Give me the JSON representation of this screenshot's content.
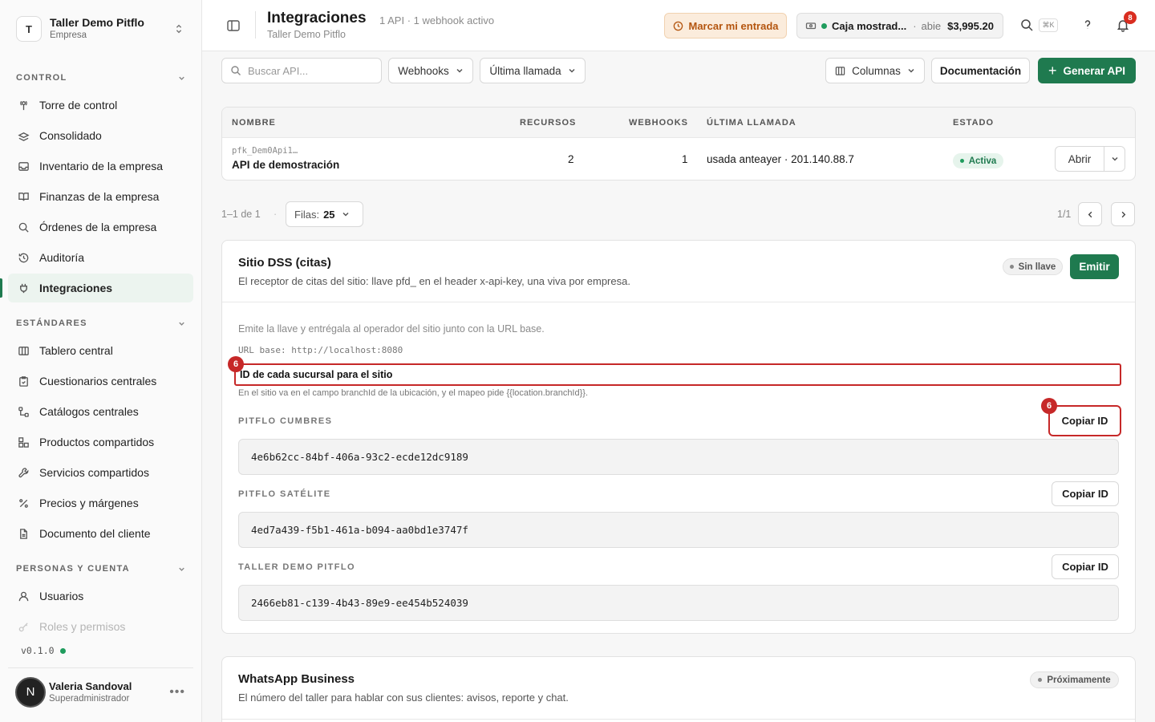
{
  "workspace": {
    "initial": "T",
    "name": "Taller Demo Pitflo",
    "type": "Empresa"
  },
  "sidebar": {
    "sections": [
      {
        "label": "CONTROL"
      },
      {
        "label": "ESTÁNDARES"
      },
      {
        "label": "PERSONAS Y CUENTA"
      }
    ],
    "items": [
      {
        "label": "Torre de control",
        "icon": "tower-icon"
      },
      {
        "label": "Consolidado",
        "icon": "layers-icon"
      },
      {
        "label": "Inventario de la empresa",
        "icon": "inbox-icon"
      },
      {
        "label": "Finanzas de la empresa",
        "icon": "book-icon"
      },
      {
        "label": "Órdenes de la empresa",
        "icon": "search-icon"
      },
      {
        "label": "Auditoría",
        "icon": "history-icon"
      },
      {
        "label": "Integraciones",
        "icon": "plug-icon"
      },
      {
        "label": "Tablero central",
        "icon": "columns-icon"
      },
      {
        "label": "Cuestionarios centrales",
        "icon": "clipboard-icon"
      },
      {
        "label": "Catálogos centrales",
        "icon": "tree-icon"
      },
      {
        "label": "Productos compartidos",
        "icon": "boxes-icon"
      },
      {
        "label": "Servicios compartidos",
        "icon": "wrench-icon"
      },
      {
        "label": "Precios y márgenes",
        "icon": "percent-icon"
      },
      {
        "label": "Documento del cliente",
        "icon": "file-icon"
      },
      {
        "label": "Usuarios",
        "icon": "user-icon"
      },
      {
        "label": "Roles y permisos",
        "icon": "key-icon"
      }
    ],
    "version": "v0.1.0"
  },
  "user": {
    "initial": "N",
    "name": "Valeria Sandoval",
    "role": "Superadministrador",
    "more": "•••"
  },
  "header": {
    "title": "Integraciones",
    "summary": "1 API · 1 webhook activo",
    "breadcrumb": "Taller Demo Pitflo",
    "clock_in": "Marcar mi entrada",
    "register": {
      "name": "Caja mostrad...",
      "sep": "·",
      "status": "abie",
      "amount": "$3,995.20"
    },
    "shortcut": "⌘K",
    "notifications": "8"
  },
  "toolbar": {
    "search_placeholder": "Buscar API...",
    "filter_webhooks": "Webhooks",
    "filter_last_call": "Última llamada",
    "columns": "Columnas",
    "docs": "Documentación",
    "generate": "Generar API",
    "generate_plus": "+"
  },
  "table": {
    "headers": [
      "NOMBRE",
      "RECURSOS",
      "WEBHOOKS",
      "ÚLTIMA LLAMADA",
      "ESTADO"
    ],
    "rows": [
      {
        "key": "pfk_Dem0Api1…",
        "name": "API de demostración",
        "resources": "2",
        "webhooks": "1",
        "last_call": "usada anteayer · 201.140.88.7",
        "status": "Activa",
        "action": "Abrir"
      }
    ]
  },
  "pagination": {
    "range": "1–1 de 1",
    "sep": "·",
    "rows_label": "Filas:",
    "rows_value": "25",
    "pages": "1/1"
  },
  "dss": {
    "title": "Sitio DSS (citas)",
    "description": "El receptor de citas del sitio: llave pfd_ en el header x-api-key, una viva por empresa.",
    "badge": "Sin llave",
    "emit": "Emitir",
    "intro": "Emite la llave y entrégala al operador del sitio junto con la URL base.",
    "url": "URL base: http://localhost:8080",
    "branch_heading": "ID de cada sucursal para el sitio",
    "branch_note": "En el sitio va en el campo branchId de la ubicación, y el mapeo pide {{location.branchId}}.",
    "marker": "6",
    "branches": [
      {
        "label": "PITFLO CUMBRES",
        "id": "4e6b62cc-84bf-406a-93c2-ecde12dc9189",
        "copy": "Copiar ID"
      },
      {
        "label": "PITFLO SATÉLITE",
        "id": "4ed7a439-f5b1-461a-b094-aa0bd1e3747f",
        "copy": "Copiar ID"
      },
      {
        "label": "TALLER DEMO PITFLO",
        "id": "2466eb81-c139-4b43-89e9-ee454b524039",
        "copy": "Copiar ID"
      }
    ]
  },
  "whatsapp": {
    "title": "WhatsApp Business",
    "description": "El número del taller para hablar con sus clientes: avisos, reporte y chat.",
    "badge": "Próximamente"
  }
}
